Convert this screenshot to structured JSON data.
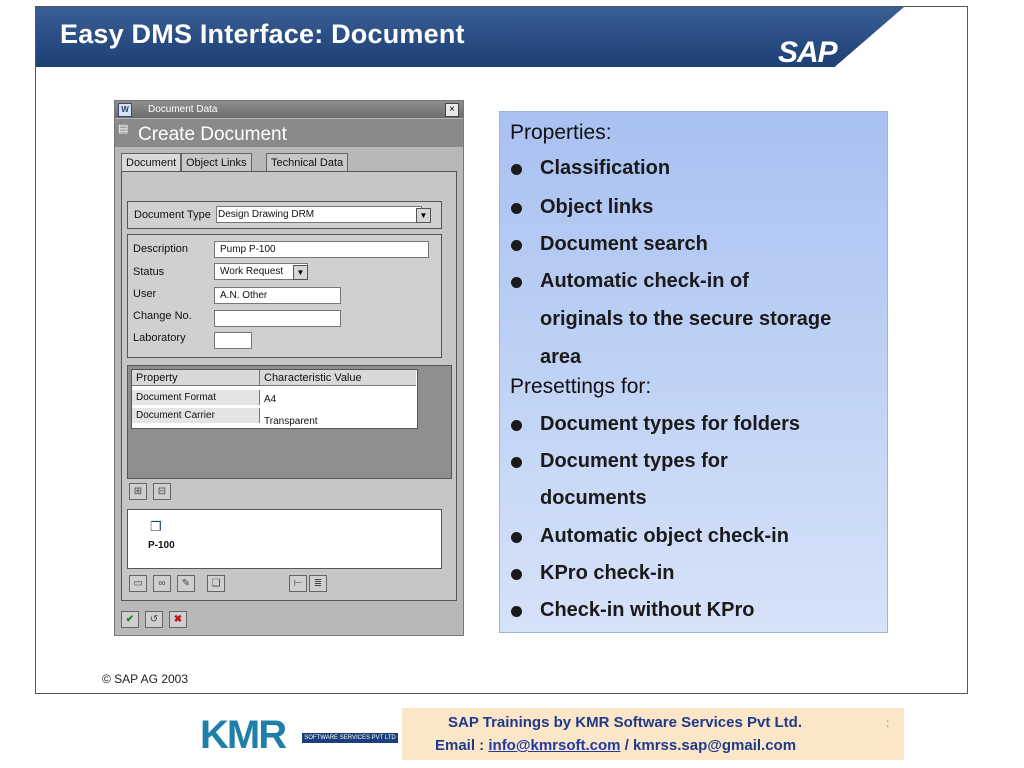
{
  "slide": {
    "title": "Easy DMS Interface: Document",
    "logo": "SAP",
    "copyright": "© SAP AG 2003"
  },
  "window": {
    "title": "Document Data",
    "close": "×",
    "heading": "Create Document",
    "tabs": [
      "Document",
      "Object Links",
      "Technical Data"
    ],
    "doc_type_label": "Document Type",
    "doc_type_value": "Design Drawing DRM",
    "fields": {
      "description_label": "Description",
      "description_value": "Pump P-100",
      "status_label": "Status",
      "status_value": "Work Request",
      "user_label": "User",
      "user_value": "A.N. Other",
      "change_label": "Change No.",
      "change_value": "",
      "lab_label": "Laboratory",
      "lab_value": ""
    },
    "grid": {
      "headers": [
        "Property",
        "Characteristic Value"
      ],
      "rows": [
        {
          "property": "Document Format",
          "value": "A4"
        },
        {
          "property": "Document Carrier",
          "value": "Transparent"
        }
      ]
    },
    "object": {
      "label": "P-100"
    }
  },
  "info": {
    "properties_heading": "Properties:",
    "properties": [
      "Classification",
      "Object links",
      "Document search",
      "Automatic check-in of",
      "originals to the secure storage",
      "area"
    ],
    "presettings_heading": "Presettings for:",
    "presettings": [
      "Document types for folders",
      "Document types for",
      "documents",
      "Automatic object check-in",
      "KPro check-in",
      "Check-in without KPro"
    ]
  },
  "footer": {
    "brand": "KMR",
    "brand_tag": "SOFTWARE SERVICES PVT LTD",
    "line1": "SAP Trainings by KMR Software Services Pvt Ltd.",
    "email_label": "Email : ",
    "email1": "info@kmrsoft.com",
    "separator": " / ",
    "email2": "kmrss.sap@gmail.com",
    "colon": ":"
  },
  "icons": {
    "confirm": "check-icon",
    "cancel": "cancel-icon",
    "object": "document-object-icon"
  }
}
